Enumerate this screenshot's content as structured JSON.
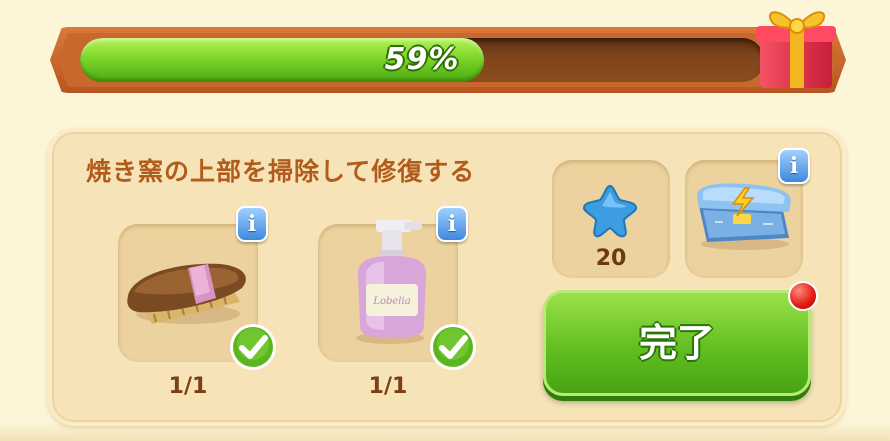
{
  "progress": {
    "value_percent": 59,
    "label": "59%",
    "fill_color": "#7dd62a"
  },
  "quest": {
    "title": "焼き窯の上部を掃除して修復する",
    "requirements": [
      {
        "item": "brush-icon",
        "count": "1/1",
        "completed": true,
        "info_label": "i"
      },
      {
        "item": "soap-bottle-icon",
        "count": "1/1",
        "completed": true,
        "info_label": "i"
      }
    ]
  },
  "rewards": [
    {
      "item": "blue-star-icon",
      "amount": "20"
    },
    {
      "item": "energy-chest-icon",
      "info_label": "i"
    }
  ],
  "done_button": {
    "label": "完了"
  },
  "colors": {
    "title": "#b25c1c",
    "panel": "#f6e4b8",
    "button": "#62bf21",
    "info_badge": "#3f88dc"
  }
}
